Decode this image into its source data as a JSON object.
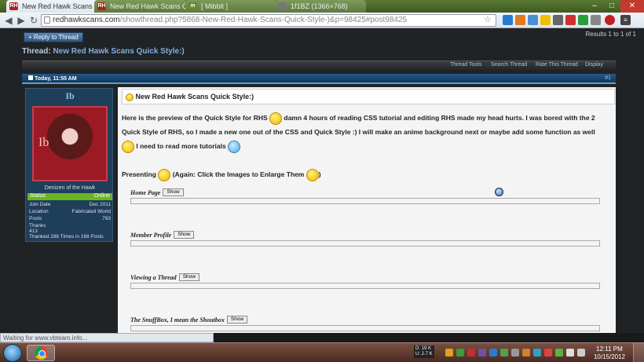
{
  "browser": {
    "tabs": [
      {
        "label": "New Red Hawk Scans Quick",
        "favicon": "RH"
      },
      {
        "label": "New Red Hawk Scans Quic",
        "favicon": "RH"
      },
      {
        "label": "[ Mibbit ]",
        "favicon": "m"
      },
      {
        "label": "1f1BZ (1366×768)",
        "favicon": ""
      }
    ],
    "url_domain": "redhawkscans.com",
    "url_path": "/showthread.php?5868-New-Red-Hawk-Scans-Quick-Style-)&p=98425#post98425",
    "status_text": "Waiting for www.vbteam.info..."
  },
  "thread": {
    "reply_button": "+ Reply to Thread",
    "results": "Results 1 to 1 of 1",
    "label": "Thread:",
    "title": "New Red Hawk Scans Quick Style:)",
    "tools": [
      "Thread Tools",
      "Search Thread",
      "Rate This Thread",
      "Display"
    ]
  },
  "post": {
    "date": "Today, 11:55 AM",
    "number": "#1",
    "title": "New Red Hawk Scans Quick Style:)",
    "text1": "Here is the preview of the Quick Style for RHS",
    "text2": "damn 4 hours of reading CSS tutorial and editing RHS made my head hurts. I was bored with the 2 Quick Style of RHS, so I made a new one out of the CSS and Quick Style :) I will make an anime background next or maybe add some function as well",
    "text3": "I need to read more tutorials",
    "presenting": "Presenting",
    "presenting_note": "(Again: Click the Images to Enlarge Them",
    "presenting_close": ")",
    "spoilers": [
      {
        "label": "Home Page",
        "button": "Show"
      },
      {
        "label": "Member Profile",
        "button": "Show"
      },
      {
        "label": "Viewing a Thread",
        "button": "Show"
      },
      {
        "label": "The SnuffBox, I mean the Shoutbox",
        "button": "Show"
      }
    ]
  },
  "user": {
    "name": "Ib",
    "avatar_text": "Ib",
    "title": "Denizen of the Hawk",
    "status_label": "Status",
    "status_value": "Online",
    "stats": [
      {
        "label": "Join Date",
        "value": "Dec 2011"
      },
      {
        "label": "Location",
        "value": "Fabricated World"
      },
      {
        "label": "Posts",
        "value": "793"
      },
      {
        "label": "Thanks",
        "value": ""
      },
      {
        "label": "413",
        "value": ""
      },
      {
        "label": "Thanked 286 Times in 168 Posts",
        "value": ""
      }
    ]
  },
  "taskbar": {
    "meter_line1": "D: 19 K",
    "meter_line2": "U: 2.7 K",
    "time": "12:11 PM",
    "date": "10/15/2012"
  },
  "colors": {
    "accent": "#5c9fd6",
    "status_online": "#6ab521",
    "link": "#7fb0e0"
  }
}
